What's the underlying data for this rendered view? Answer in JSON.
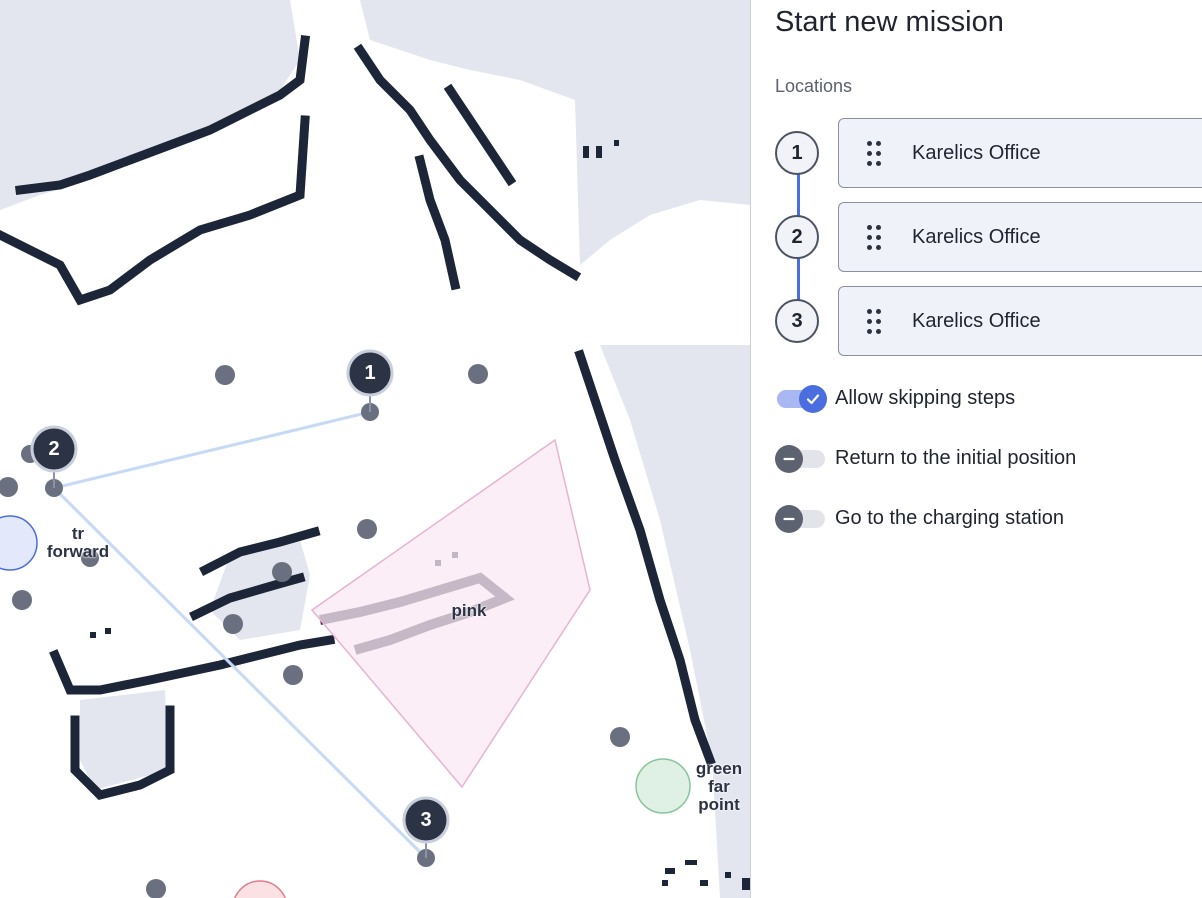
{
  "map": {
    "zone_labels": [
      {
        "name": "tr forward",
        "line1": "tr",
        "line2": "forward"
      },
      {
        "name": "pink",
        "text": "pink"
      },
      {
        "name": "green far point",
        "line1": "green",
        "line2": "far",
        "line3": "point"
      }
    ],
    "markers": [
      "1",
      "2",
      "3"
    ],
    "colors": {
      "obstacle": "#1d2538",
      "unknown": "#e3e6ee",
      "route": "#c7daf5",
      "pink_zone": "#f9e8f3",
      "green_zone": "#dff0e4",
      "blue_zone": "#e3e8fb",
      "waypoint": "#6b7080",
      "marker": "#2c3345"
    }
  },
  "panel": {
    "title": "Start new mission",
    "locations_label": "Locations",
    "steps": [
      {
        "number": "1",
        "location": "Karelics Office"
      },
      {
        "number": "2",
        "location": "Karelics Office"
      },
      {
        "number": "3",
        "location": "Karelics Office"
      }
    ],
    "options": [
      {
        "label": "Allow skipping steps",
        "on": true
      },
      {
        "label": "Return to the initial position",
        "on": false
      },
      {
        "label": "Go to the charging station",
        "on": false
      }
    ],
    "colors": {
      "accent": "#4a6ee0",
      "toggle_off": "#5d6270"
    }
  }
}
